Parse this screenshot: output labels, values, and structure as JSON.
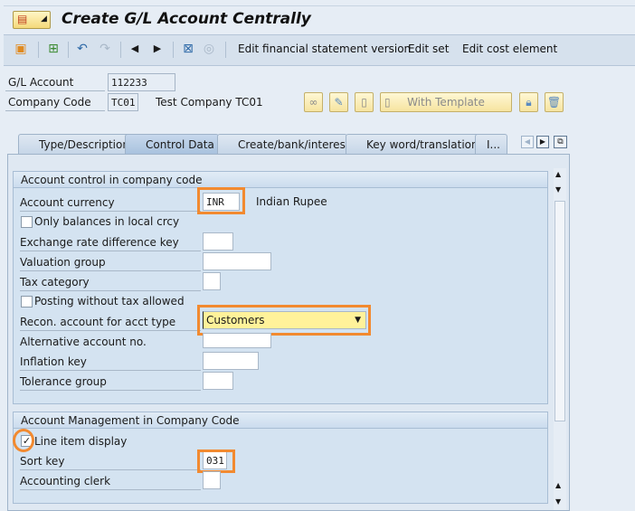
{
  "window": {
    "title": "Create G/L Account Centrally"
  },
  "toolbar": {
    "items": [
      "Edit financial statement version",
      "Edit set",
      "Edit cost element"
    ]
  },
  "header": {
    "gl_account_label": "G/L Account",
    "gl_account_value": "112233",
    "company_code_label": "Company Code",
    "company_code_value": "TC01",
    "company_name": "Test Company TC01",
    "with_template_label": "With Template"
  },
  "tabs": [
    {
      "label": "Type/Description"
    },
    {
      "label": "Control Data",
      "active": true
    },
    {
      "label": "Create/bank/interest"
    },
    {
      "label": "Key word/translation"
    },
    {
      "label": "I..."
    }
  ],
  "group1": {
    "title": "Account control in company code",
    "account_currency_label": "Account currency",
    "account_currency_value": "INR",
    "currency_name": "Indian Rupee",
    "only_balances_label": "Only balances in local crcy",
    "only_balances_checked": false,
    "exchange_rate_label": "Exchange rate difference key",
    "valuation_group_label": "Valuation group",
    "tax_category_label": "Tax category",
    "posting_without_tax_label": "Posting without tax allowed",
    "posting_without_tax_checked": false,
    "recon_label": "Recon. account for acct type",
    "recon_value": "Customers",
    "alt_account_label": "Alternative account no.",
    "inflation_key_label": "Inflation key",
    "tolerance_group_label": "Tolerance group"
  },
  "group2": {
    "title": "Account Management in Company Code",
    "line_item_label": "Line item display",
    "line_item_checked": true,
    "check_mark": "✓",
    "sort_key_label": "Sort key",
    "sort_key_value": "031",
    "accounting_clerk_label": "Accounting clerk"
  },
  "colors": {
    "highlight": "#f28a30",
    "dropdown_bg": "#fff29a"
  }
}
